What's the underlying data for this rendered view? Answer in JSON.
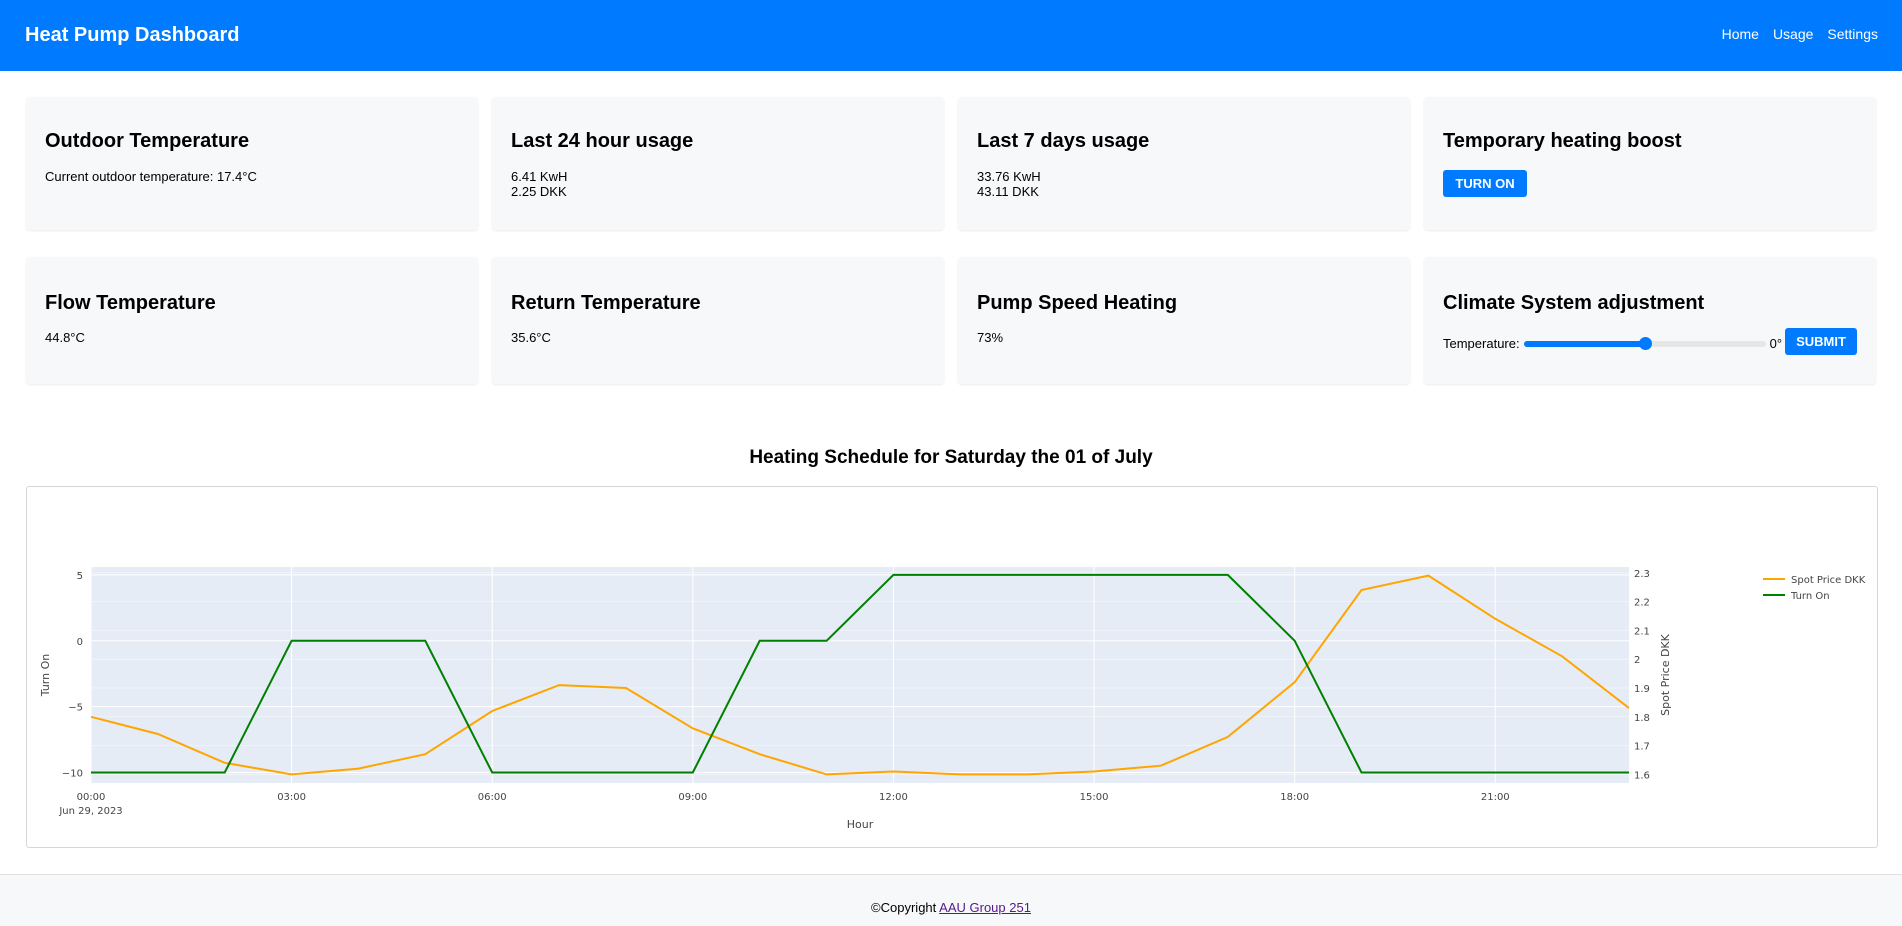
{
  "navbar": {
    "brand": "Heat Pump Dashboard",
    "links": [
      "Home",
      "Usage",
      "Settings"
    ],
    "color": "#007bff"
  },
  "cards": {
    "outdoor": {
      "title": "Outdoor Temperature",
      "line1": "Current outdoor temperature: 17.4°C"
    },
    "usage24": {
      "title": "Last 24 hour usage",
      "line1": "6.41 KwH",
      "line2": "2.25 DKK"
    },
    "usage7": {
      "title": "Last 7 days usage",
      "line1": "33.76 KwH",
      "line2": "43.11 DKK"
    },
    "boost": {
      "title": "Temporary heating boost",
      "button": "TURN ON"
    },
    "flow": {
      "title": "Flow Temperature",
      "line1": "44.8°C"
    },
    "return": {
      "title": "Return Temperature",
      "line1": "35.6°C"
    },
    "pump": {
      "title": "Pump Speed Heating",
      "line1": "73%"
    },
    "climate": {
      "title": "Climate System adjustment",
      "label": "Temperature:",
      "value": "0°",
      "slider_fraction": 0.5,
      "button": "SUBMIT"
    }
  },
  "chart_title": "Heating Schedule for Saturday the 01 of July",
  "chart_data": {
    "type": "line",
    "x": [
      "00:00",
      "01:00",
      "02:00",
      "03:00",
      "04:00",
      "05:00",
      "06:00",
      "07:00",
      "08:00",
      "09:00",
      "10:00",
      "11:00",
      "12:00",
      "13:00",
      "14:00",
      "15:00",
      "16:00",
      "17:00",
      "18:00",
      "19:00",
      "20:00",
      "21:00",
      "22:00",
      "23:00"
    ],
    "x_ticks": [
      "00:00",
      "03:00",
      "06:00",
      "09:00",
      "12:00",
      "15:00",
      "18:00",
      "21:00"
    ],
    "x_date_label": "Jun 29, 2023",
    "xlabel": "Hour",
    "ylabel": "Turn On",
    "y2label": "Spot Price DKK",
    "y_ticks": [
      "5",
      "0",
      "−5",
      "−10"
    ],
    "y2_ticks": [
      "2.3",
      "2.2",
      "2.1",
      "2",
      "1.9",
      "1.8",
      "1.7",
      "1.6"
    ],
    "ylim": [
      -10.8,
      5.6
    ],
    "y2lim": [
      1.57,
      2.32
    ],
    "series": [
      {
        "name": "Spot Price DKK",
        "axis": "y2",
        "color": "#ffa500",
        "values": [
          1.8,
          1.74,
          1.64,
          1.6,
          1.62,
          1.67,
          1.82,
          1.91,
          1.9,
          1.76,
          1.67,
          1.6,
          1.61,
          1.6,
          1.6,
          1.61,
          1.63,
          1.73,
          1.92,
          2.24,
          2.29,
          2.14,
          2.01,
          1.83
        ]
      },
      {
        "name": "Turn On",
        "axis": "y",
        "color": "#008000",
        "values": [
          -10,
          -10,
          -10,
          0,
          0,
          0,
          -10,
          -10,
          -10,
          -10,
          0,
          0,
          5,
          5,
          5,
          5,
          5,
          5,
          0,
          -10,
          -10,
          -10,
          -10,
          -10
        ]
      }
    ],
    "legend": "top-right",
    "grid": true
  },
  "footer": {
    "prefix": "©Copyright ",
    "link": "AAU Group 251"
  }
}
